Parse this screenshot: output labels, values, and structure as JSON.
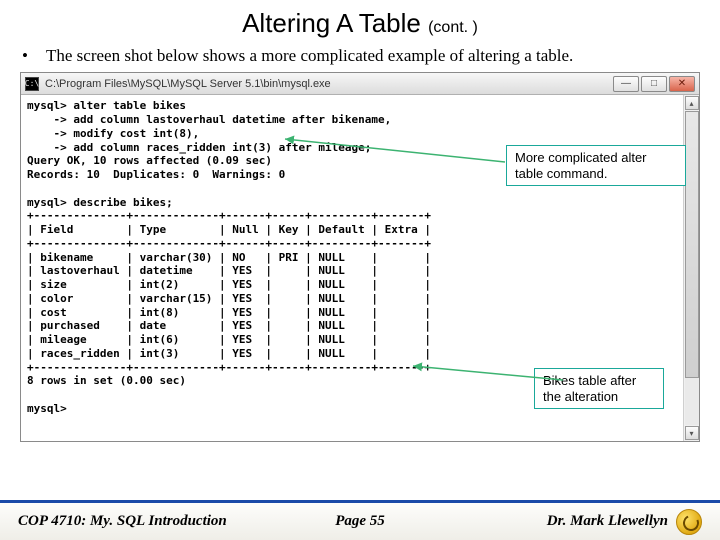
{
  "title_main": "Altering A Table ",
  "title_cont": "(cont. )",
  "bullet": "The screen shot below shows a more complicated example of altering a table.",
  "window_title": "C:\\Program Files\\MySQL\\MySQL Server 5.1\\bin\\mysql.exe",
  "callout1": "More complicated alter table command.",
  "callout2": "Bikes table after the alteration",
  "footer_left": "COP 4710: My. SQL Introduction",
  "footer_mid": "Page 55",
  "footer_right": "Dr. Mark Llewellyn",
  "terminal": "mysql> alter table bikes\n    -> add column lastoverhaul datetime after bikename,\n    -> modify cost int(8),\n    -> add column races_ridden int(3) after mileage;\nQuery OK, 10 rows affected (0.09 sec)\nRecords: 10  Duplicates: 0  Warnings: 0\n\nmysql> describe bikes;\n+--------------+-------------+------+-----+---------+-------+\n| Field        | Type        | Null | Key | Default | Extra |\n+--------------+-------------+------+-----+---------+-------+\n| bikename     | varchar(30) | NO   | PRI | NULL    |       |\n| lastoverhaul | datetime    | YES  |     | NULL    |       |\n| size         | int(2)      | YES  |     | NULL    |       |\n| color        | varchar(15) | YES  |     | NULL    |       |\n| cost         | int(8)      | YES  |     | NULL    |       |\n| purchased    | date        | YES  |     | NULL    |       |\n| mileage      | int(6)      | YES  |     | NULL    |       |\n| races_ridden | int(3)      | YES  |     | NULL    |       |\n+--------------+-------------+------+-----+---------+-------+\n8 rows in set (0.00 sec)\n\nmysql>"
}
